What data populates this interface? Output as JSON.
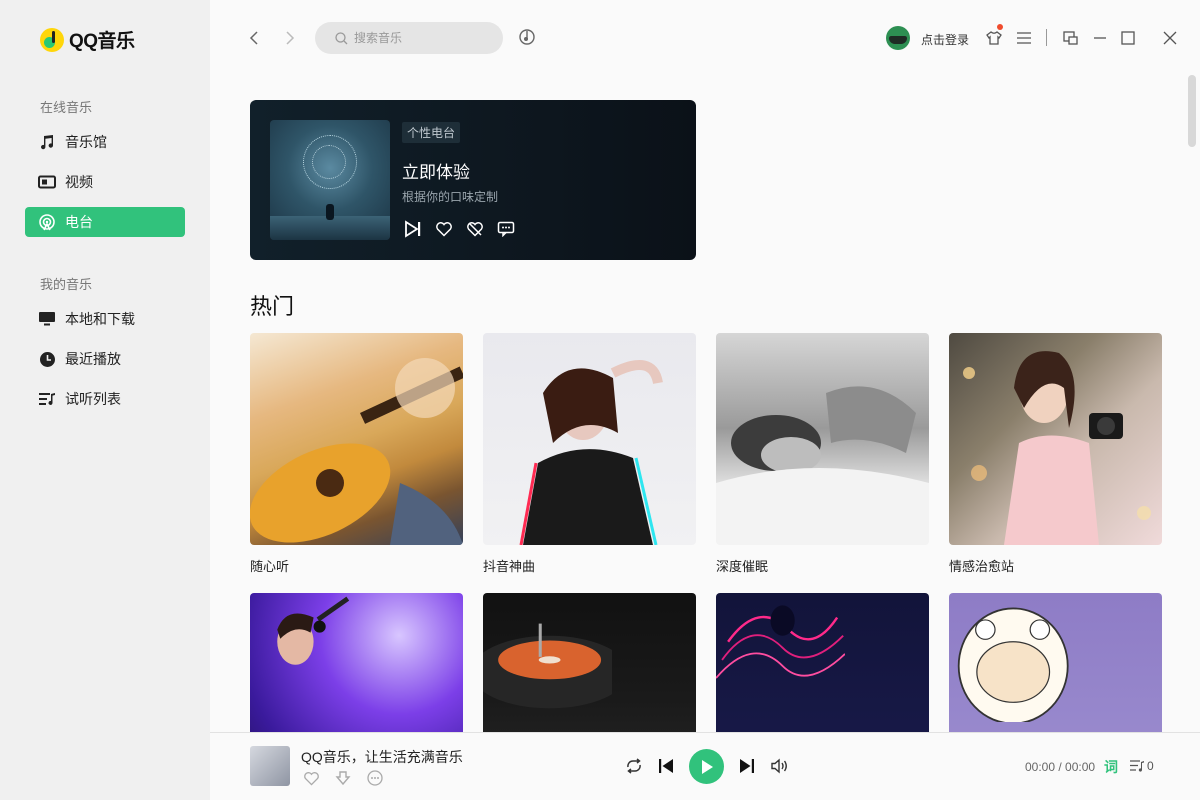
{
  "app": {
    "name": "QQ音乐"
  },
  "sidebar": {
    "online_label": "在线音乐",
    "online_items": [
      {
        "label": "音乐馆",
        "icon": "music-note-icon"
      },
      {
        "label": "视频",
        "icon": "video-icon"
      },
      {
        "label": "电台",
        "icon": "radio-icon",
        "active": true
      }
    ],
    "my_label": "我的音乐",
    "my_items": [
      {
        "label": "本地和下载",
        "icon": "monitor-icon"
      },
      {
        "label": "最近播放",
        "icon": "clock-icon"
      },
      {
        "label": "试听列表",
        "icon": "playlist-icon"
      }
    ]
  },
  "topbar": {
    "search_placeholder": "搜索音乐",
    "login_label": "点击登录"
  },
  "radio_card": {
    "tag": "个性电台",
    "title": "立即体验",
    "subtitle": "根据你的口味定制"
  },
  "hot": {
    "title": "热门",
    "items": [
      {
        "label": "随心听"
      },
      {
        "label": "抖音神曲"
      },
      {
        "label": "深度催眠"
      },
      {
        "label": "情感治愈站"
      },
      {
        "label": ""
      },
      {
        "label": ""
      },
      {
        "label": ""
      },
      {
        "label": ""
      }
    ]
  },
  "player": {
    "title": "QQ音乐，让生活充满音乐",
    "time": "00:00 / 00:00",
    "lyric_label": "词",
    "playlist_count": "0"
  },
  "colors": {
    "accent": "#31c27c",
    "notification": "#f04b2d"
  }
}
